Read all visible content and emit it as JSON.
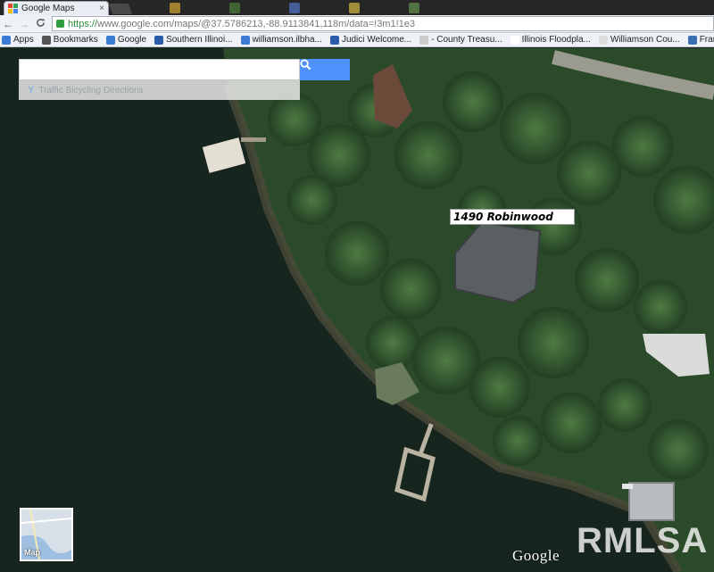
{
  "browser": {
    "tab": {
      "title": "Google Maps",
      "close": "×"
    },
    "nav": {
      "back": "←",
      "forward": "→",
      "reload": "C"
    },
    "url": {
      "secure_part": "https://",
      "rest": "www.google.com/maps/@37.5786213,-88.9113841,118m/data=!3m1!1e3"
    },
    "bookmarks": [
      {
        "label": "Apps",
        "icon": "apps-icon",
        "color": "#3b7bd6"
      },
      {
        "label": "Bookmarks",
        "icon": "star-icon",
        "color": "#555555"
      },
      {
        "label": "Google",
        "icon": "google-icon",
        "color": "#3b7bd6"
      },
      {
        "label": "Southern Illinoi...",
        "icon": "bookmark-icon",
        "color": "#2a5caa"
      },
      {
        "label": "williamson.ilbha...",
        "icon": "bookmark-icon",
        "color": "#3b7bd6"
      },
      {
        "label": "Judici Welcome...",
        "icon": "bookmark-icon",
        "color": "#2a5caa"
      },
      {
        "label": "- County Treasu...",
        "icon": "page-icon",
        "color": "#cccccc"
      },
      {
        "label": "Illinois Floodpla...",
        "icon": "page-icon",
        "color": "#ffffff"
      },
      {
        "label": "Williamson Cou...",
        "icon": "page-icon",
        "color": "#dddddd"
      },
      {
        "label": "Franklin Coun",
        "icon": "bookmark-icon",
        "color": "#3b6fb0"
      }
    ]
  },
  "map": {
    "search": {
      "value": "",
      "placeholder": ""
    },
    "links": {
      "traffic": "Traffic",
      "bicycling": "Bicycling",
      "directions": "Directions"
    },
    "address_label": "1490 Robinwood",
    "thumbnail_label": "Map",
    "attribution": "Google",
    "watermark": "RMLSA"
  },
  "colors": {
    "accent": "#4d90fe",
    "water": "#17251f",
    "trees": "#2f5530"
  }
}
